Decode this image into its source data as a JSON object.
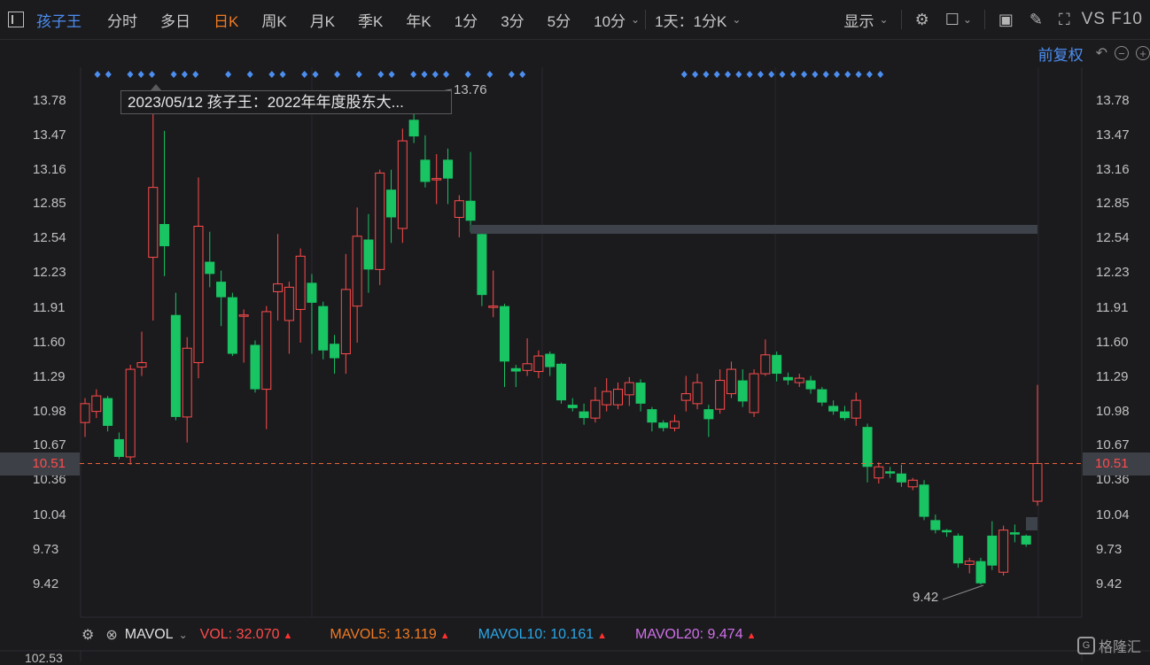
{
  "toolbar": {
    "stock_name": "孩子王",
    "tabs": [
      "分时",
      "多日",
      "日K",
      "周K",
      "月K",
      "季K",
      "年K",
      "1分",
      "3分",
      "5分",
      "10分"
    ],
    "active_tab": "日K",
    "period_select": "1天：1分K",
    "display_label": "显示",
    "vs_f10": "VS F10"
  },
  "subbar": {
    "adjust_label": "前复权"
  },
  "tooltip": {
    "text": "2023/05/12 孩子王：2022年年度股东大..."
  },
  "price_axis": [
    "13.78",
    "13.47",
    "13.16",
    "12.85",
    "12.54",
    "12.23",
    "11.91",
    "11.60",
    "11.29",
    "10.98",
    "10.67",
    "10.36",
    "10.04",
    "9.73",
    "9.42"
  ],
  "current_price": "10.51",
  "high_label": "13.76",
  "low_label": "9.42",
  "volume_bar": {
    "indicator": "MAVOL",
    "vol_label": "VOL:",
    "vol_value": "32.070",
    "mavol5_label": "MAVOL5:",
    "mavol5_value": "13.119",
    "mavol10_label": "MAVOL10:",
    "mavol10_value": "10.161",
    "mavol20_label": "MAVOL20:",
    "mavol20_value": "9.474"
  },
  "vol_axis_partial": "102.53",
  "brand": "格隆汇",
  "colors": {
    "up": "#ff4b4b",
    "down": "#19c463",
    "accent": "#4c8ef0",
    "active_tab": "#f07a22",
    "mavol5": "#f07a22",
    "mavol10": "#2aa7e8",
    "mavol20": "#d070e8"
  },
  "chart_data": {
    "type": "candlestick",
    "ylim": [
      9.2,
      14.0
    ],
    "candles": [
      {
        "o": 10.88,
        "c": 11.05,
        "h": 11.1,
        "l": 10.75
      },
      {
        "o": 10.98,
        "c": 11.12,
        "h": 11.18,
        "l": 10.92
      },
      {
        "o": 11.1,
        "c": 10.85,
        "h": 11.12,
        "l": 10.8
      },
      {
        "o": 10.73,
        "c": 10.57,
        "h": 10.79,
        "l": 10.55
      },
      {
        "o": 10.57,
        "c": 11.36,
        "h": 11.4,
        "l": 10.5
      },
      {
        "o": 11.38,
        "c": 11.42,
        "h": 11.7,
        "l": 11.3
      },
      {
        "o": 12.37,
        "c": 13.0,
        "h": 13.7,
        "l": 11.8
      },
      {
        "o": 12.67,
        "c": 12.47,
        "h": 13.51,
        "l": 12.2
      },
      {
        "o": 11.85,
        "c": 10.93,
        "h": 12.05,
        "l": 10.9
      },
      {
        "o": 10.93,
        "c": 11.55,
        "h": 11.65,
        "l": 10.7
      },
      {
        "o": 11.42,
        "c": 12.65,
        "h": 13.09,
        "l": 11.28
      },
      {
        "o": 12.33,
        "c": 12.22,
        "h": 12.6,
        "l": 12.1
      },
      {
        "o": 12.15,
        "c": 12.01,
        "h": 12.25,
        "l": 11.75
      },
      {
        "o": 12.01,
        "c": 11.5,
        "h": 12.05,
        "l": 11.48
      },
      {
        "o": 11.85,
        "c": 11.85,
        "h": 11.9,
        "l": 11.42
      },
      {
        "o": 11.58,
        "c": 11.18,
        "h": 11.62,
        "l": 11.15
      },
      {
        "o": 11.18,
        "c": 11.88,
        "h": 11.93,
        "l": 10.82
      },
      {
        "o": 12.06,
        "c": 12.13,
        "h": 12.58,
        "l": 11.8
      },
      {
        "o": 11.8,
        "c": 12.1,
        "h": 12.15,
        "l": 11.5
      },
      {
        "o": 11.9,
        "c": 12.38,
        "h": 12.45,
        "l": 11.6
      },
      {
        "o": 12.14,
        "c": 11.96,
        "h": 12.22,
        "l": 11.5
      },
      {
        "o": 11.93,
        "c": 11.53,
        "h": 11.97,
        "l": 11.45
      },
      {
        "o": 11.59,
        "c": 11.46,
        "h": 11.67,
        "l": 11.32
      },
      {
        "o": 11.5,
        "c": 12.08,
        "h": 12.4,
        "l": 11.32
      },
      {
        "o": 11.93,
        "c": 12.56,
        "h": 12.82,
        "l": 11.6
      },
      {
        "o": 12.53,
        "c": 12.26,
        "h": 12.76,
        "l": 12.05
      },
      {
        "o": 12.26,
        "c": 13.13,
        "h": 13.16,
        "l": 12.12
      },
      {
        "o": 12.98,
        "c": 12.73,
        "h": 13.16,
        "l": 12.5
      },
      {
        "o": 12.63,
        "c": 13.42,
        "h": 13.53,
        "l": 12.5
      },
      {
        "o": 13.61,
        "c": 13.46,
        "h": 13.76,
        "l": 13.4
      },
      {
        "o": 13.25,
        "c": 13.05,
        "h": 13.47,
        "l": 13.0
      },
      {
        "o": 13.08,
        "c": 13.08,
        "h": 13.3,
        "l": 12.85
      },
      {
        "o": 13.25,
        "c": 13.08,
        "h": 13.35,
        "l": 12.85
      },
      {
        "o": 12.73,
        "c": 12.88,
        "h": 12.93,
        "l": 12.55
      },
      {
        "o": 12.88,
        "c": 12.7,
        "h": 13.32,
        "l": 12.6
      },
      {
        "o": 12.58,
        "c": 12.03,
        "h": 12.62,
        "l": 11.93
      },
      {
        "o": 11.93,
        "c": 11.93,
        "h": 12.25,
        "l": 11.83
      },
      {
        "o": 11.93,
        "c": 11.43,
        "h": 11.95,
        "l": 11.2
      },
      {
        "o": 11.37,
        "c": 11.34,
        "h": 11.4,
        "l": 11.2
      },
      {
        "o": 11.35,
        "c": 11.41,
        "h": 11.64,
        "l": 11.3
      },
      {
        "o": 11.34,
        "c": 11.48,
        "h": 11.53,
        "l": 11.28
      },
      {
        "o": 11.5,
        "c": 11.38,
        "h": 11.52,
        "l": 11.3
      },
      {
        "o": 11.41,
        "c": 11.08,
        "h": 11.42,
        "l": 11.05
      },
      {
        "o": 11.04,
        "c": 11.01,
        "h": 11.1,
        "l": 10.98
      },
      {
        "o": 10.98,
        "c": 10.92,
        "h": 11.05,
        "l": 10.86
      },
      {
        "o": 10.92,
        "c": 11.08,
        "h": 11.2,
        "l": 10.88
      },
      {
        "o": 11.04,
        "c": 11.16,
        "h": 11.28,
        "l": 10.98
      },
      {
        "o": 11.04,
        "c": 11.18,
        "h": 11.24,
        "l": 11.0
      },
      {
        "o": 11.13,
        "c": 11.24,
        "h": 11.29,
        "l": 11.03
      },
      {
        "o": 11.24,
        "c": 11.05,
        "h": 11.27,
        "l": 10.98
      },
      {
        "o": 11.0,
        "c": 10.88,
        "h": 11.02,
        "l": 10.8
      },
      {
        "o": 10.88,
        "c": 10.83,
        "h": 10.9,
        "l": 10.8
      },
      {
        "o": 10.83,
        "c": 10.89,
        "h": 10.95,
        "l": 10.8
      },
      {
        "o": 11.08,
        "c": 11.14,
        "h": 11.3,
        "l": 10.98
      },
      {
        "o": 11.05,
        "c": 11.24,
        "h": 11.32,
        "l": 11.0
      },
      {
        "o": 11.0,
        "c": 10.91,
        "h": 11.04,
        "l": 10.75
      },
      {
        "o": 11.0,
        "c": 11.26,
        "h": 11.36,
        "l": 10.96
      },
      {
        "o": 11.14,
        "c": 11.36,
        "h": 11.43,
        "l": 11.1
      },
      {
        "o": 11.26,
        "c": 11.07,
        "h": 11.36,
        "l": 11.02
      },
      {
        "o": 10.97,
        "c": 11.32,
        "h": 11.36,
        "l": 10.93
      },
      {
        "o": 11.32,
        "c": 11.49,
        "h": 11.63,
        "l": 11.3
      },
      {
        "o": 11.49,
        "c": 11.32,
        "h": 11.52,
        "l": 11.25
      },
      {
        "o": 11.29,
        "c": 11.26,
        "h": 11.33,
        "l": 11.22
      },
      {
        "o": 11.24,
        "c": 11.28,
        "h": 11.32,
        "l": 11.2
      },
      {
        "o": 11.26,
        "c": 11.18,
        "h": 11.3,
        "l": 11.14
      },
      {
        "o": 11.18,
        "c": 11.06,
        "h": 11.2,
        "l": 11.03
      },
      {
        "o": 11.03,
        "c": 10.98,
        "h": 11.08,
        "l": 10.95
      },
      {
        "o": 10.98,
        "c": 10.92,
        "h": 11.03,
        "l": 10.9
      },
      {
        "o": 10.92,
        "c": 11.08,
        "h": 11.15,
        "l": 10.85
      },
      {
        "o": 10.84,
        "c": 10.48,
        "h": 10.87,
        "l": 10.34
      },
      {
        "o": 10.38,
        "c": 10.48,
        "h": 10.52,
        "l": 10.33
      },
      {
        "o": 10.44,
        "c": 10.42,
        "h": 10.48,
        "l": 10.38
      },
      {
        "o": 10.42,
        "c": 10.34,
        "h": 10.5,
        "l": 10.3
      },
      {
        "o": 10.3,
        "c": 10.36,
        "h": 10.38,
        "l": 10.27
      },
      {
        "o": 10.32,
        "c": 10.03,
        "h": 10.36,
        "l": 10.0
      },
      {
        "o": 10.0,
        "c": 9.91,
        "h": 10.05,
        "l": 9.88
      },
      {
        "o": 9.91,
        "c": 9.89,
        "h": 9.92,
        "l": 9.85
      },
      {
        "o": 9.86,
        "c": 9.61,
        "h": 9.88,
        "l": 9.57
      },
      {
        "o": 9.6,
        "c": 9.63,
        "h": 9.66,
        "l": 9.52
      },
      {
        "o": 9.63,
        "c": 9.43,
        "h": 9.66,
        "l": 9.42
      },
      {
        "o": 9.86,
        "c": 9.59,
        "h": 9.99,
        "l": 9.55
      },
      {
        "o": 9.53,
        "c": 9.91,
        "h": 9.95,
        "l": 9.5
      },
      {
        "o": 9.89,
        "c": 9.87,
        "h": 9.96,
        "l": 9.8
      },
      {
        "o": 9.86,
        "c": 9.78,
        "h": 9.87,
        "l": 9.76
      },
      {
        "o": 10.17,
        "c": 10.51,
        "h": 11.22,
        "l": 10.13
      }
    ],
    "event_markers_idx": [
      0,
      1,
      3,
      4,
      5,
      7,
      8,
      9,
      12,
      14,
      16,
      17,
      19,
      20,
      22,
      24,
      26,
      27,
      29,
      30,
      31,
      32,
      34,
      36,
      38,
      39,
      41,
      42,
      43,
      44,
      45,
      46,
      47,
      48,
      49,
      50,
      51,
      52,
      53,
      54,
      55,
      56,
      57,
      58,
      59
    ]
  }
}
